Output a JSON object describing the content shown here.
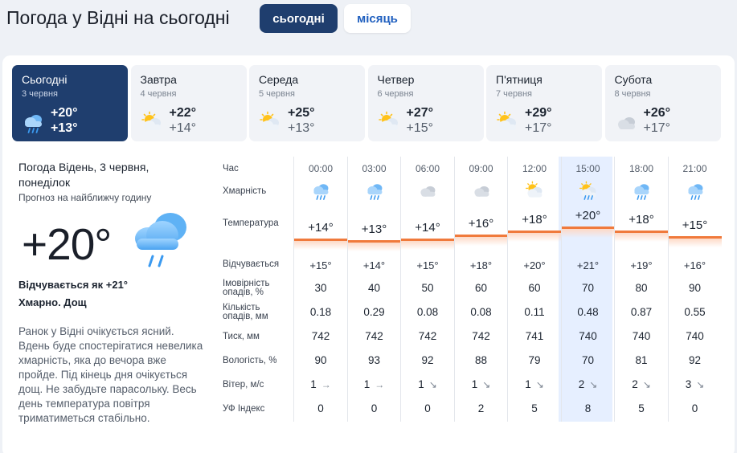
{
  "header": {
    "title": "Погода у Відні на сьогодні",
    "tab_today": "сьогодні",
    "tab_month": "місяць"
  },
  "days": [
    {
      "name": "Сьогодні",
      "date": "3 червня",
      "max": "+20°",
      "min": "+13°",
      "icon": "cloud-rain-icon"
    },
    {
      "name": "Завтра",
      "date": "4 червня",
      "max": "+22°",
      "min": "+14°",
      "icon": "partly-cloudy-icon"
    },
    {
      "name": "Середа",
      "date": "5 червня",
      "max": "+25°",
      "min": "+13°",
      "icon": "partly-cloudy-icon"
    },
    {
      "name": "Четвер",
      "date": "6 червня",
      "max": "+27°",
      "min": "+15°",
      "icon": "partly-cloudy-icon"
    },
    {
      "name": "П'ятниця",
      "date": "7 червня",
      "max": "+29°",
      "min": "+17°",
      "icon": "partly-cloudy-icon"
    },
    {
      "name": "Субота",
      "date": "8 червня",
      "max": "+26°",
      "min": "+17°",
      "icon": "cloudy-icon"
    }
  ],
  "current": {
    "location": "Погода Відень, 3 червня, понеділок",
    "note": "Прогноз на найближчу годину",
    "temp": "+20°",
    "feels": "Відчувається як +21°",
    "condition": "Хмарно. Дощ",
    "description": "Ранок у Відні очікується ясний. Вдень буде спостерігатися невелика хмарність, яка до вечора вже пройде. Під кінець дня очікується дощ. Не забудьте парасольку. Весь день температура повітря триматиметься стабільно."
  },
  "labels": {
    "time": "Час",
    "cloud": "Хмарність",
    "temperature": "Температура",
    "feels": "Відчувається",
    "precip_prob": "Імовірність опадів, %",
    "precip_amount": "Кількість опадів, мм",
    "pressure": "Тиск, мм",
    "humidity": "Вологість, %",
    "wind": "Вітер, м/с",
    "uv": "УФ Індекс"
  },
  "hours": [
    {
      "time": "00:00",
      "icon": "cloud-rain-icon",
      "temp": "+14°",
      "temp_value": 14,
      "feels": "+15°",
      "prob": "30",
      "amount": "0.18",
      "pressure": "742",
      "humidity": "90",
      "wind": "1",
      "wind_dir": "→",
      "uv": "0"
    },
    {
      "time": "03:00",
      "icon": "cloud-rain-icon",
      "temp": "+13°",
      "temp_value": 13,
      "feels": "+14°",
      "prob": "40",
      "amount": "0.29",
      "pressure": "742",
      "humidity": "93",
      "wind": "1",
      "wind_dir": "→",
      "uv": "0"
    },
    {
      "time": "06:00",
      "icon": "cloudy-icon",
      "temp": "+14°",
      "temp_value": 14,
      "feels": "+15°",
      "prob": "50",
      "amount": "0.08",
      "pressure": "742",
      "humidity": "92",
      "wind": "1",
      "wind_dir": "↘",
      "uv": "0"
    },
    {
      "time": "09:00",
      "icon": "cloudy-icon",
      "temp": "+16°",
      "temp_value": 16,
      "feels": "+18°",
      "prob": "60",
      "amount": "0.08",
      "pressure": "742",
      "humidity": "88",
      "wind": "1",
      "wind_dir": "↘",
      "uv": "2"
    },
    {
      "time": "12:00",
      "icon": "partly-cloudy-icon",
      "temp": "+18°",
      "temp_value": 18,
      "feels": "+20°",
      "prob": "60",
      "amount": "0.11",
      "pressure": "741",
      "humidity": "79",
      "wind": "1",
      "wind_dir": "↘",
      "uv": "5"
    },
    {
      "time": "15:00",
      "icon": "partly-cloudy-rain-icon",
      "temp": "+20°",
      "temp_value": 20,
      "feels": "+21°",
      "prob": "70",
      "amount": "0.48",
      "pressure": "740",
      "humidity": "70",
      "wind": "2",
      "wind_dir": "↘",
      "uv": "8"
    },
    {
      "time": "18:00",
      "icon": "cloud-rain-icon",
      "temp": "+18°",
      "temp_value": 18,
      "feels": "+19°",
      "prob": "80",
      "amount": "0.87",
      "pressure": "740",
      "humidity": "81",
      "wind": "2",
      "wind_dir": "↘",
      "uv": "5"
    },
    {
      "time": "21:00",
      "icon": "cloud-rain-icon",
      "temp": "+15°",
      "temp_value": 15,
      "feels": "+16°",
      "prob": "90",
      "amount": "0.55",
      "pressure": "740",
      "humidity": "92",
      "wind": "3",
      "wind_dir": "↘",
      "uv": "0"
    }
  ],
  "colors": {
    "accent": "#1f3e6e",
    "link": "#1f5fbf",
    "temp_line": "#f07a3c",
    "highlight": "#e6efff"
  }
}
